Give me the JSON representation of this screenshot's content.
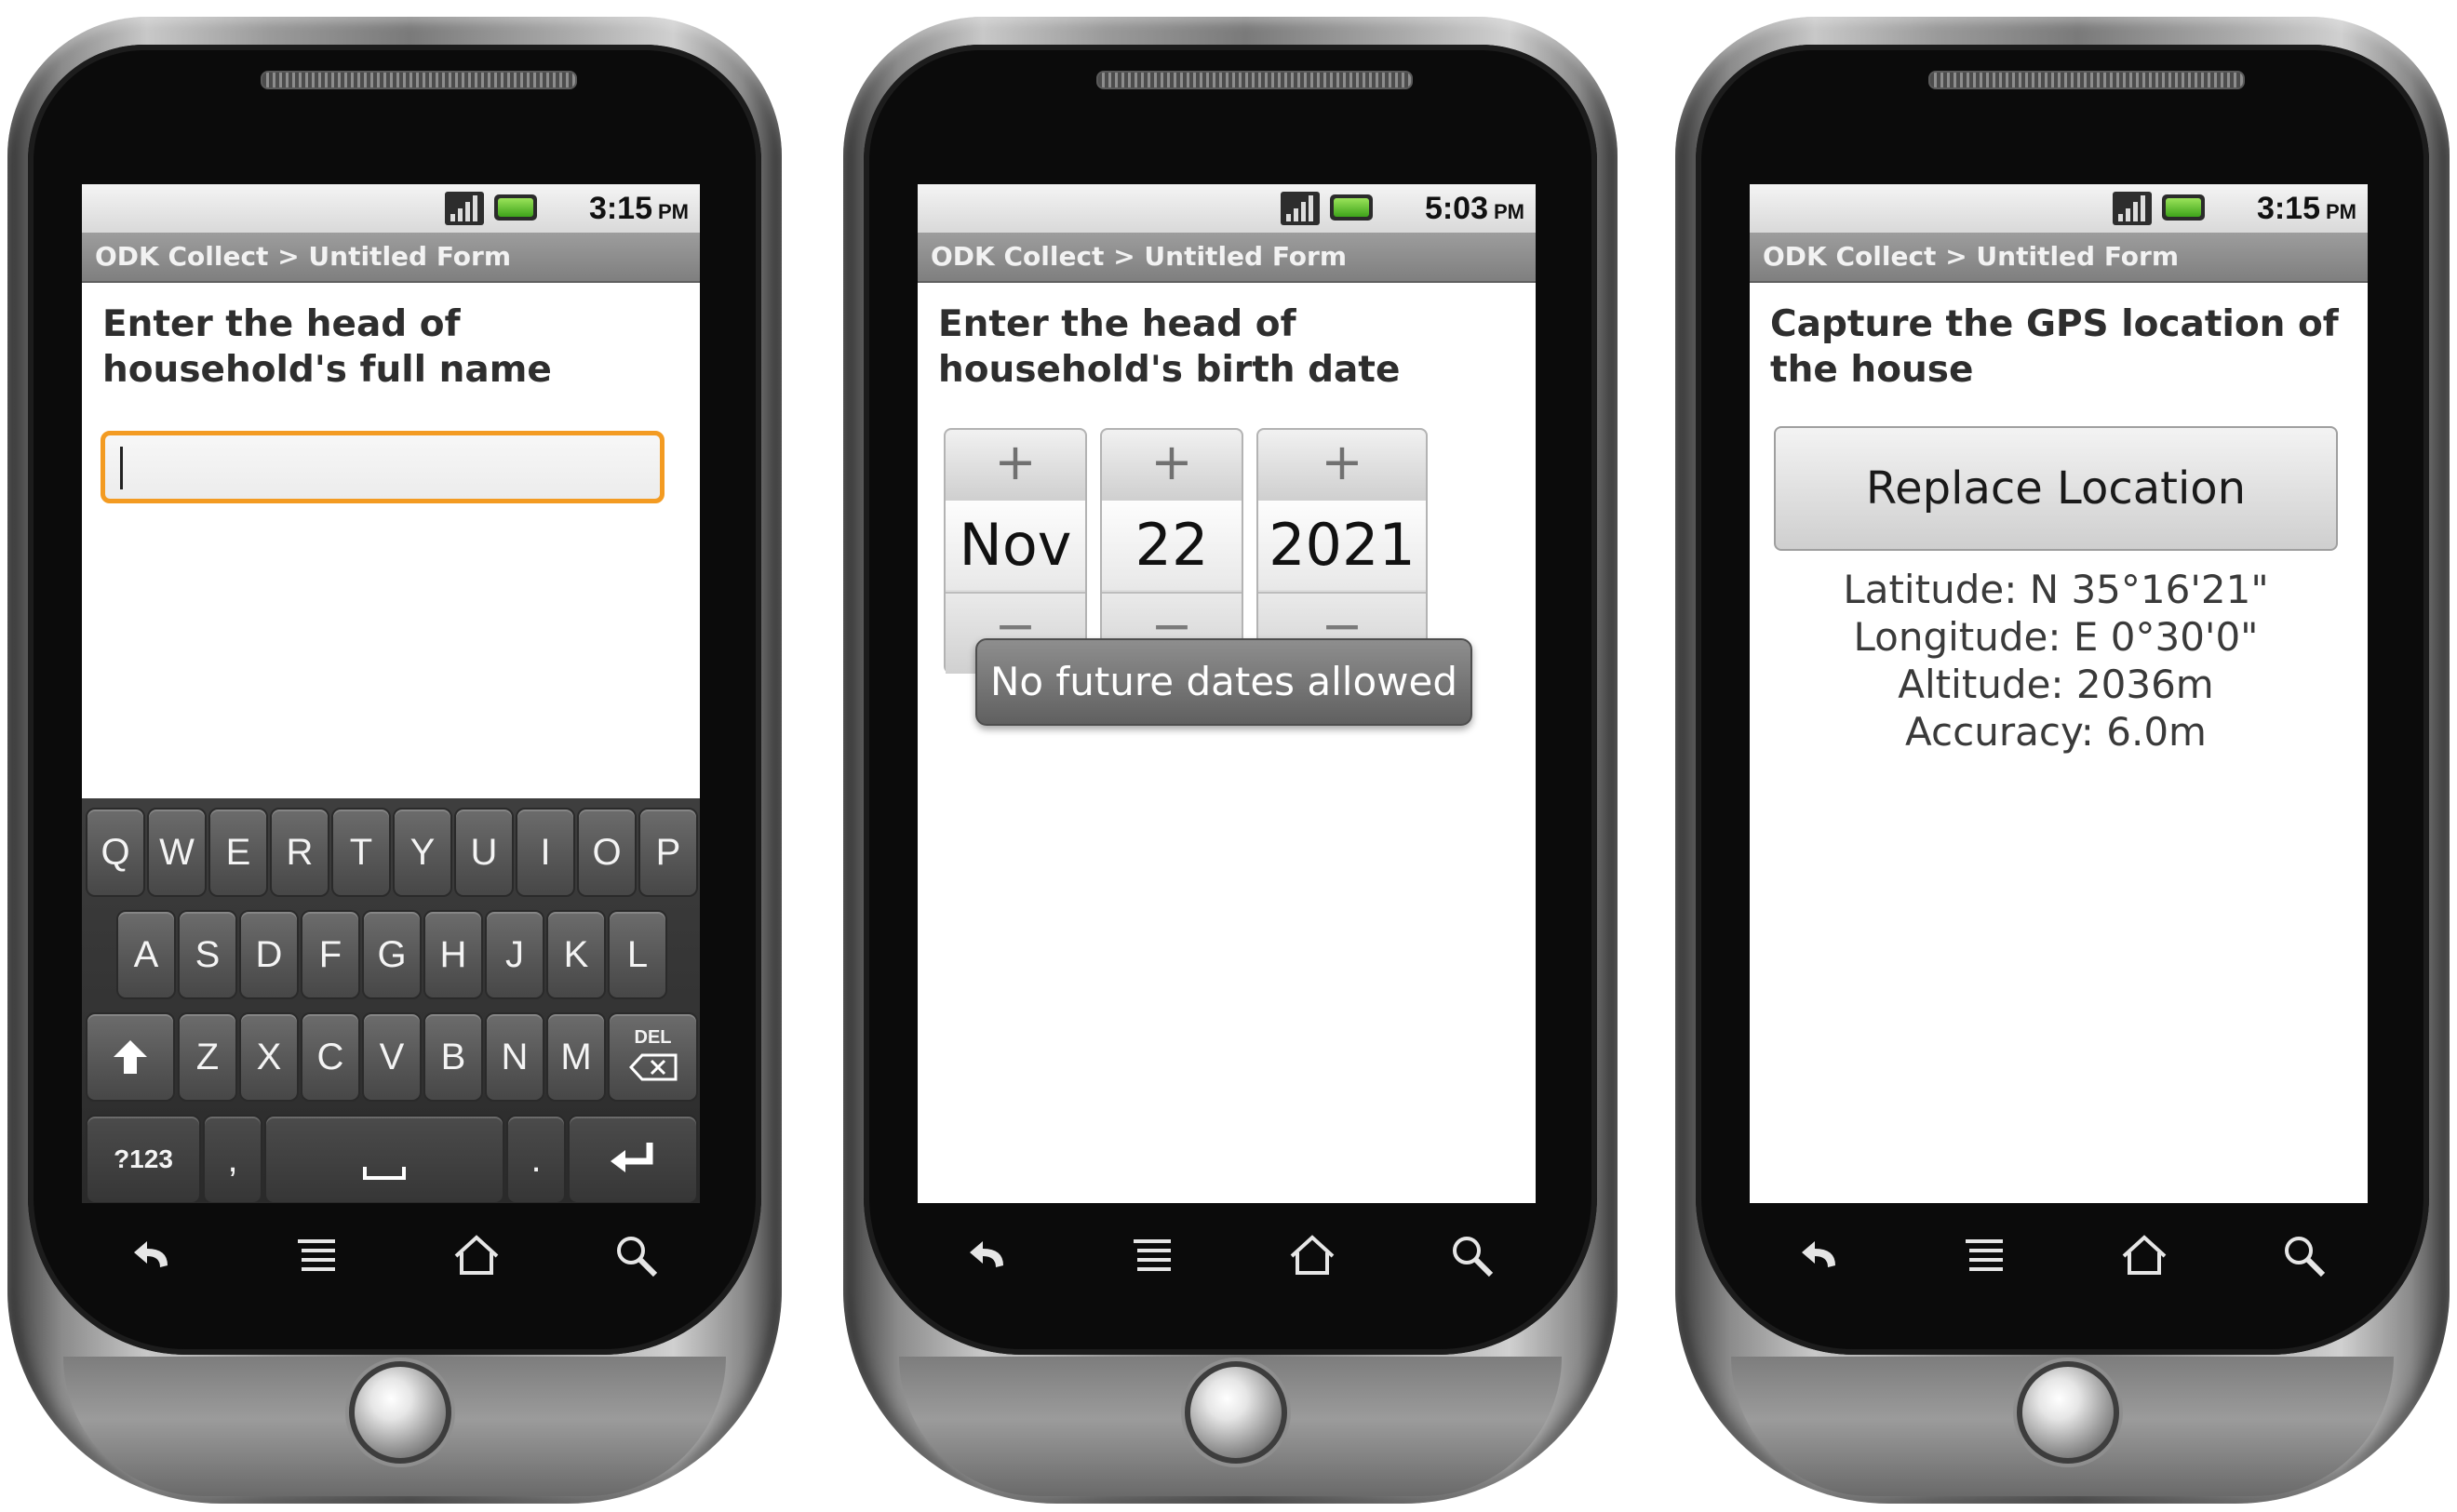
{
  "phones": [
    {
      "status": {
        "time": "3:15",
        "ampm": "PM"
      },
      "title": "ODK Collect > Untitled Form",
      "question": "Enter the head of household's full name",
      "input": {
        "value": "",
        "placeholder": ""
      },
      "keyboard": {
        "row1": [
          "Q",
          "W",
          "E",
          "R",
          "T",
          "Y",
          "U",
          "I",
          "O",
          "P"
        ],
        "row2": [
          "A",
          "S",
          "D",
          "F",
          "G",
          "H",
          "J",
          "K",
          "L"
        ],
        "row3": [
          "Z",
          "X",
          "C",
          "V",
          "B",
          "N",
          "M"
        ],
        "del_label": "DEL",
        "symbols_label": "?123",
        "comma": ",",
        "period": "."
      }
    },
    {
      "status": {
        "time": "5:03",
        "ampm": "PM"
      },
      "title": "ODK Collect > Untitled Form",
      "question": "Enter the head of household's birth date",
      "date": {
        "month": "Nov",
        "day": "22",
        "year": "2021",
        "plus": "+",
        "minus": "−"
      },
      "toast": "No future dates allowed"
    },
    {
      "status": {
        "time": "3:15",
        "ampm": "PM"
      },
      "title": "ODK Collect > Untitled Form",
      "question": "Capture the GPS location of the house",
      "button": "Replace Location",
      "gps": {
        "latitude": "Latitude: N 35°16'21\"",
        "longitude": "Longitude: E 0°30'0\"",
        "altitude": "Altitude: 2036m",
        "accuracy": "Accuracy: 6.0m"
      }
    }
  ],
  "nav_icons": [
    "back-icon",
    "menu-icon",
    "home-icon",
    "search-icon"
  ],
  "colors": {
    "input_focus": "#f39b22",
    "title_bar": "#8a8a8a",
    "battery": "#5cc22a"
  }
}
